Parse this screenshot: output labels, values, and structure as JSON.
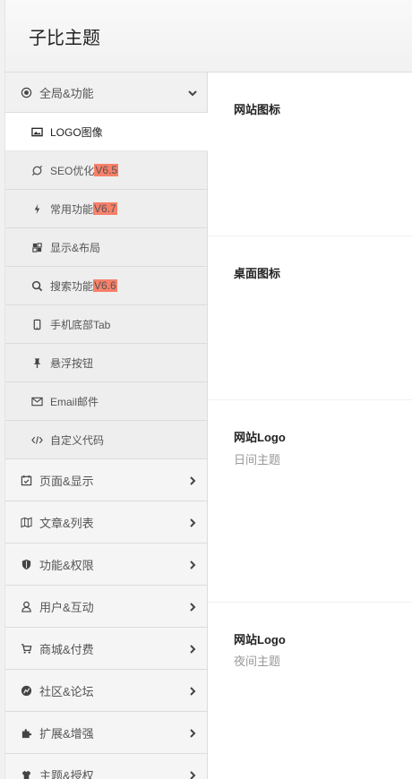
{
  "header": {
    "title": "子比主题"
  },
  "sidebar": {
    "sections": {
      "global": {
        "label": "全局&功能",
        "icon": "target-icon"
      },
      "page": {
        "label": "页面&显示",
        "icon": "calendar-icon"
      },
      "article": {
        "label": "文章&列表",
        "icon": "map-icon"
      },
      "permission": {
        "label": "功能&权限",
        "icon": "shield-icon"
      },
      "user": {
        "label": "用户&互动",
        "icon": "user-icon"
      },
      "mall": {
        "label": "商城&付费",
        "icon": "cart-icon"
      },
      "community": {
        "label": "社区&论坛",
        "icon": "community-icon"
      },
      "extend": {
        "label": "扩展&增强",
        "icon": "puzzle-icon"
      },
      "theme": {
        "label": "主题&授权",
        "icon": "theme-icon"
      }
    },
    "sub_items": {
      "logo": {
        "label": "LOGO图像",
        "icon": "image-icon"
      },
      "seo": {
        "label": "SEO优化",
        "badge": "V6.5",
        "icon": "seo-icon"
      },
      "common": {
        "label": "常用功能",
        "badge": "V6.7",
        "icon": "bolt-icon"
      },
      "layout": {
        "label": "显示&布局",
        "icon": "layout-icon"
      },
      "search": {
        "label": "搜索功能",
        "badge": "V6.6",
        "icon": "search-icon"
      },
      "tab": {
        "label": "手机底部Tab",
        "icon": "mobile-icon"
      },
      "float": {
        "label": "悬浮按钮",
        "icon": "pin-icon"
      },
      "email": {
        "label": "Email邮件",
        "icon": "mail-icon"
      },
      "code": {
        "label": "自定义代码",
        "icon": "code-icon"
      }
    }
  },
  "main": {
    "fields": {
      "favicon": {
        "title": "网站图标"
      },
      "desktop_icon": {
        "title": "桌面图标"
      },
      "logo_day": {
        "title": "网站Logo",
        "subtitle": "日间主题"
      },
      "logo_night": {
        "title": "网站Logo",
        "subtitle": "夜间主题"
      }
    }
  },
  "colors": {
    "badge_bg": "#f7806a",
    "active_bg": "#ffffff",
    "sidebar_bg": "#f5f5f5"
  }
}
